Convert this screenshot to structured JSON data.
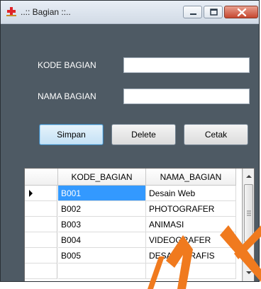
{
  "window": {
    "title": "..:: Bagian ::..",
    "titlebar_color": "#d8e1ec",
    "body_color": "#4e5a64"
  },
  "form": {
    "kode_label": "KODE BAGIAN",
    "kode_value": "",
    "nama_label": "NAMA BAGIAN",
    "nama_value": ""
  },
  "buttons": {
    "simpan": "Simpan",
    "delete": "Delete",
    "cetak": "Cetak"
  },
  "grid": {
    "columns": [
      "KODE_BAGIAN",
      "NAMA_BAGIAN"
    ],
    "rows": [
      {
        "kode": "B001",
        "nama": "Desain Web"
      },
      {
        "kode": "B002",
        "nama": "PHOTOGRAFER"
      },
      {
        "kode": "B003",
        "nama": "ANIMASI"
      },
      {
        "kode": "B004",
        "nama": "VIDEOGRAFER"
      },
      {
        "kode": "B005",
        "nama": "DESAIN GRAFIS"
      }
    ],
    "selected_row": 0,
    "selection_color": "#3399ff"
  },
  "icons": {
    "app": "red-cross-icon",
    "minimize": "minimize-icon",
    "maximize": "maximize-icon",
    "close": "close-icon",
    "row_pointer": "row-pointer-icon"
  }
}
